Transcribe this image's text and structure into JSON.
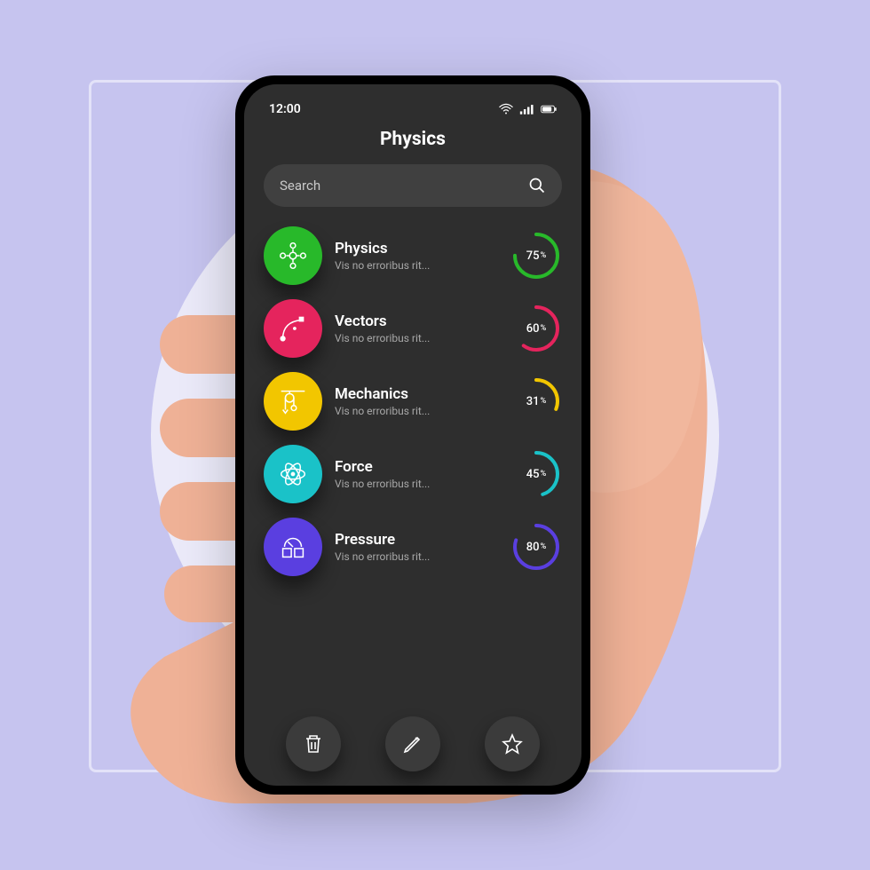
{
  "status": {
    "time": "12:00"
  },
  "header": {
    "title": "Physics"
  },
  "search": {
    "placeholder": "Search"
  },
  "topics": [
    {
      "key": "physics",
      "title": "Physics",
      "subtitle": "Vis no erroribus rit...",
      "percent": 75,
      "color": "#28b92a",
      "icon": "molecule"
    },
    {
      "key": "vectors",
      "title": "Vectors",
      "subtitle": "Vis no erroribus rit...",
      "percent": 60,
      "color": "#e5245d",
      "icon": "vector"
    },
    {
      "key": "mechanics",
      "title": "Mechanics",
      "subtitle": "Vis no erroribus rit...",
      "percent": 31,
      "color": "#f2c600",
      "icon": "pulley"
    },
    {
      "key": "force",
      "title": "Force",
      "subtitle": "Vis no erroribus rit...",
      "percent": 45,
      "color": "#1ac2c8",
      "icon": "atom"
    },
    {
      "key": "pressure",
      "title": "Pressure",
      "subtitle": "Vis no erroribus rit...",
      "percent": 80,
      "color": "#5a3fe0",
      "icon": "gauge"
    }
  ],
  "bottom_buttons": [
    {
      "name": "trash-button",
      "icon": "trash"
    },
    {
      "name": "edit-button",
      "icon": "pencil"
    },
    {
      "name": "star-button",
      "icon": "star"
    }
  ]
}
